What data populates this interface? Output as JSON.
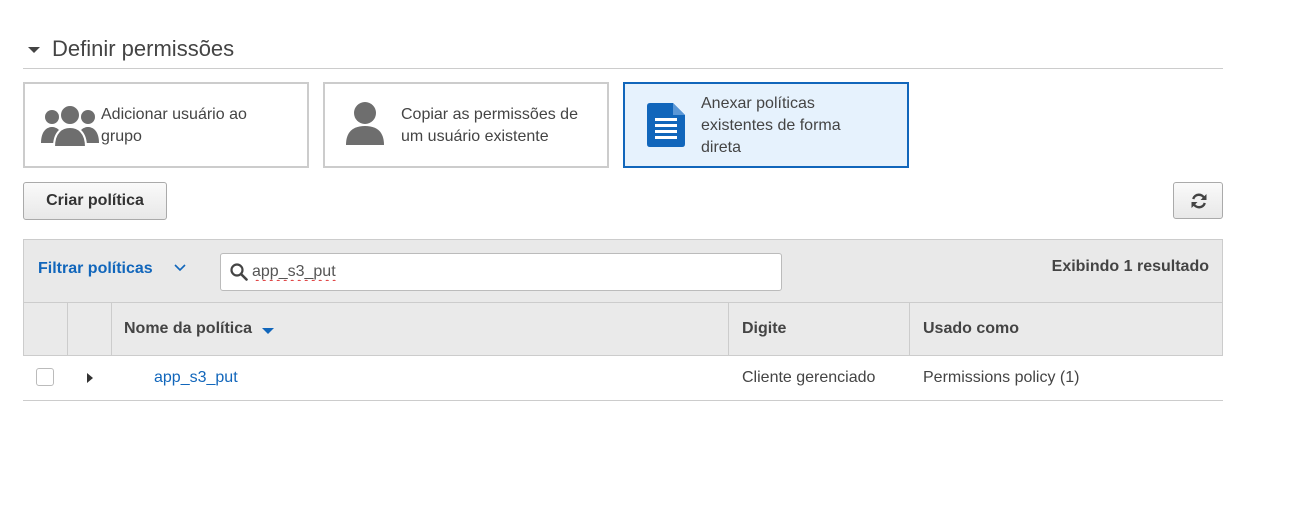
{
  "section": {
    "title": "Definir permissões"
  },
  "options": [
    {
      "label_line1": "Adicionar usuário ao",
      "label_line2": "grupo",
      "icon": "group-icon"
    },
    {
      "label_line1": "Copiar as permissões de",
      "label_line2": "um usuário existente",
      "icon": "user-icon"
    },
    {
      "label_line1": "Anexar políticas",
      "label_line2": "existentes de forma",
      "label_line3": "direta",
      "icon": "document-icon",
      "selected": true
    }
  ],
  "toolbar": {
    "create_label": "Criar política",
    "refresh_icon": "refresh-icon"
  },
  "filter": {
    "dropdown_label": "Filtrar políticas",
    "search_value": "app_s3_put",
    "result_count": "Exibindo 1 resultado"
  },
  "table": {
    "columns": [
      "Nome da política",
      "Digite",
      "Usado como"
    ],
    "rows": [
      {
        "name": "app_s3_put",
        "type": "Cliente gerenciado",
        "used_as": "Permissions policy (1)"
      }
    ]
  },
  "colors": {
    "accent": "#1166bb",
    "selected_bg": "#e6f2fd",
    "border": "#cccccc"
  }
}
